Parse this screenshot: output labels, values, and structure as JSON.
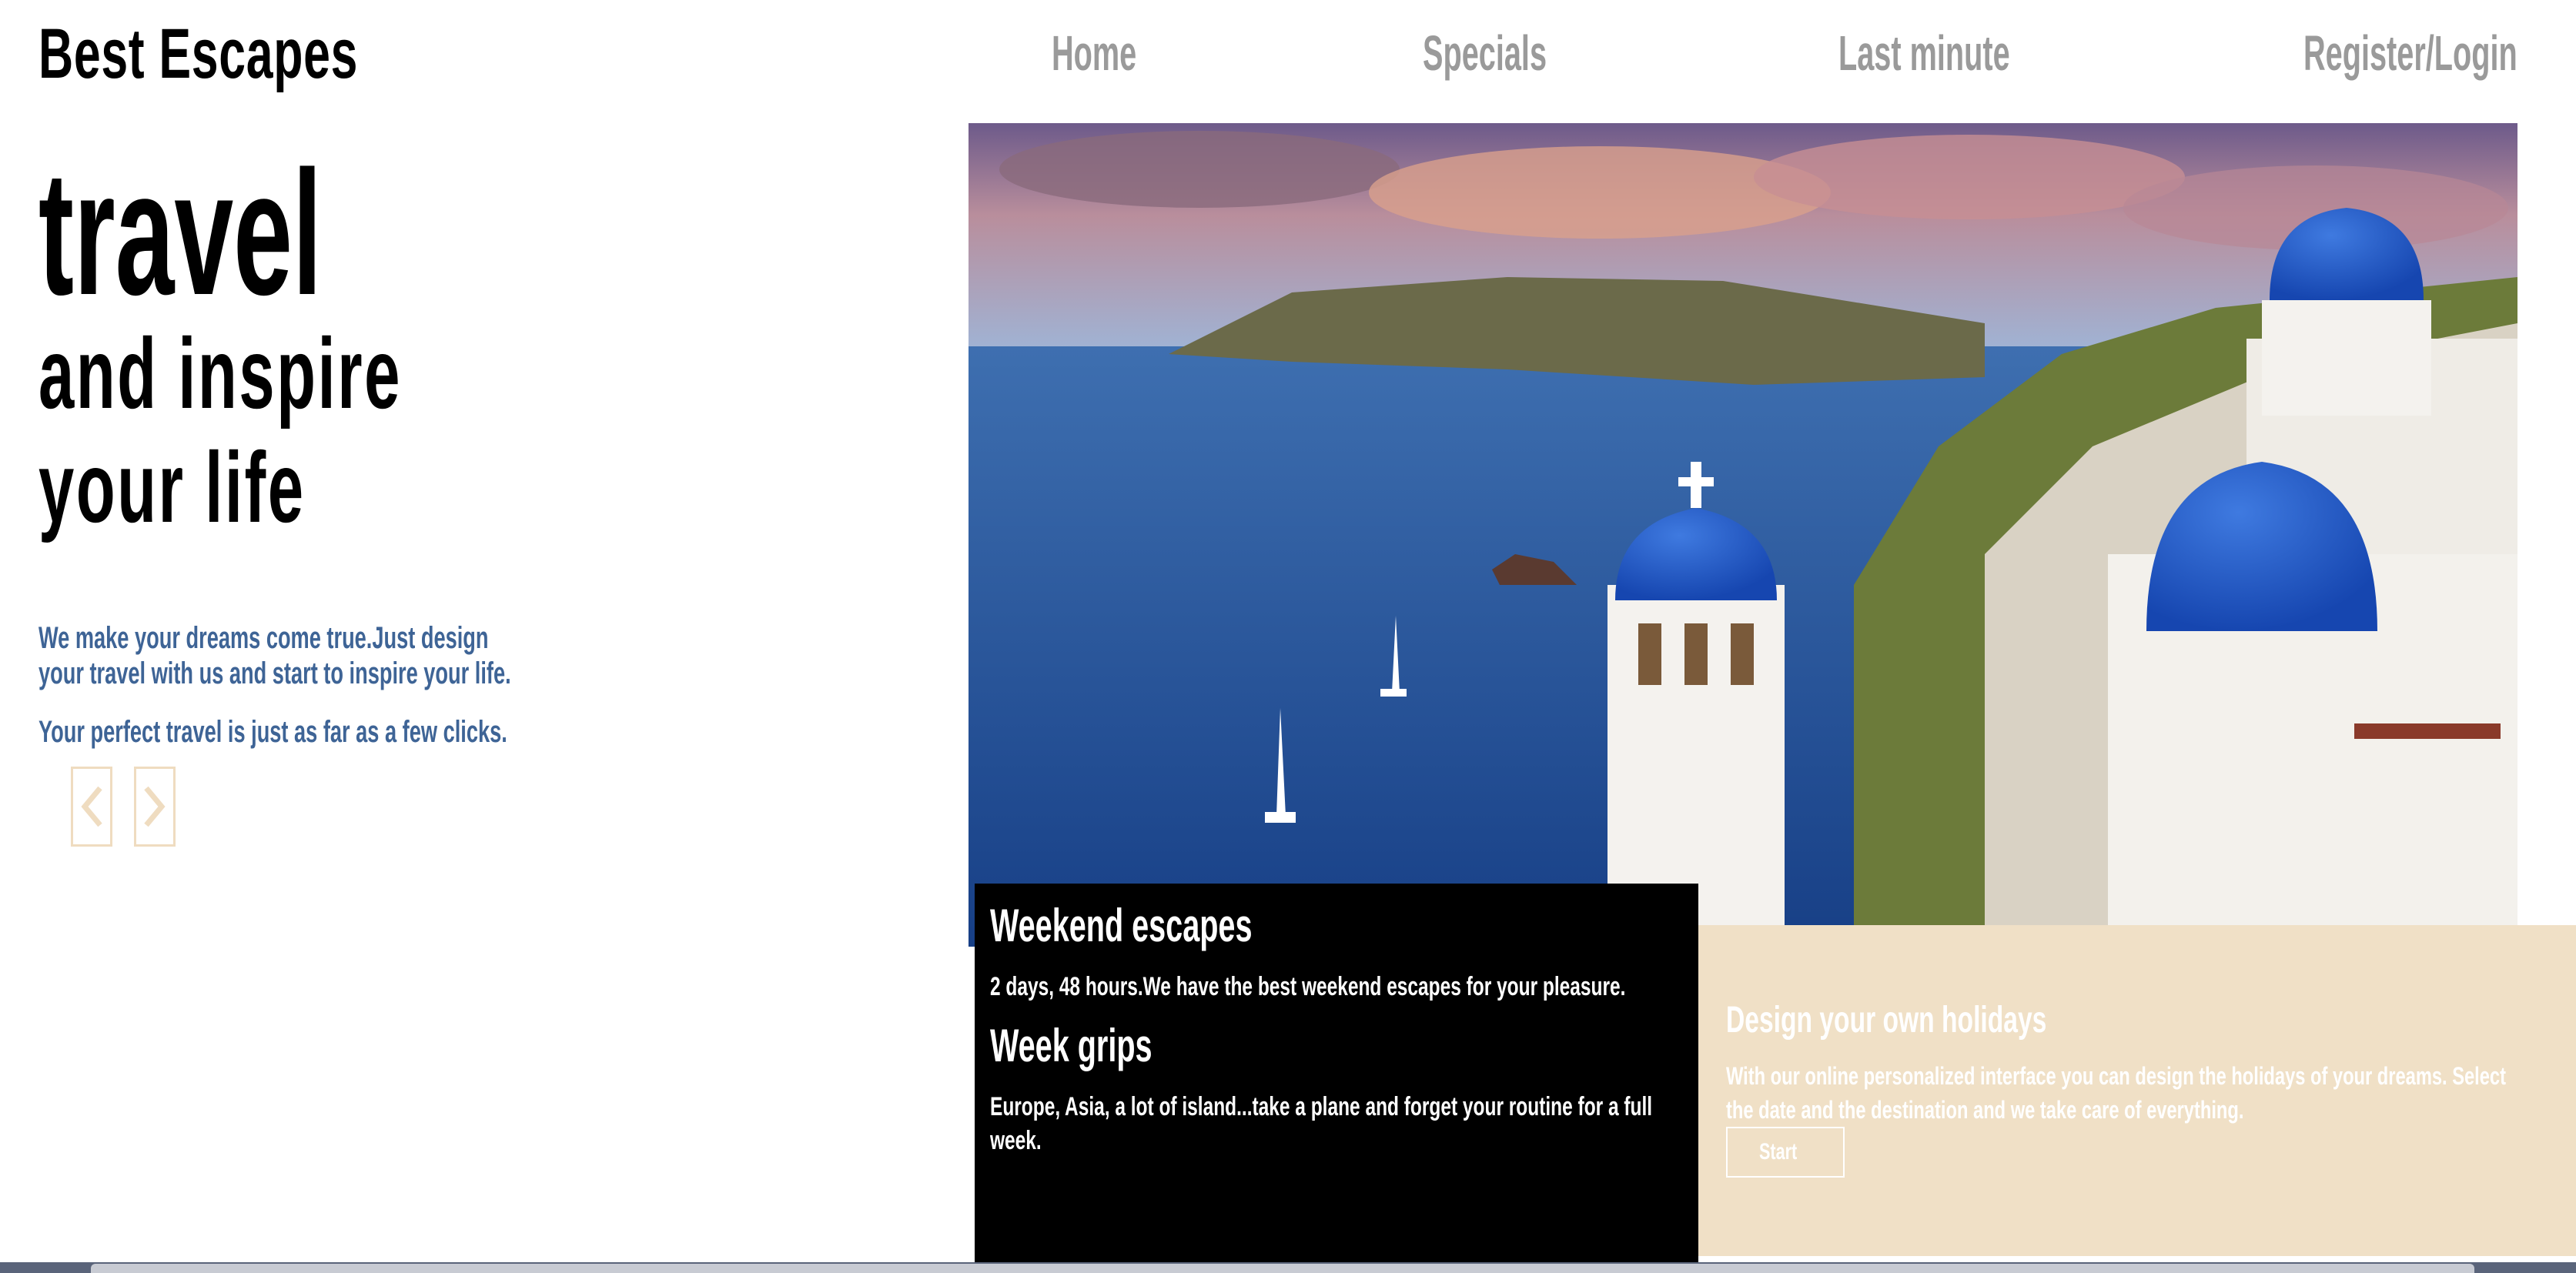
{
  "brand": {
    "name": "Best Escapes"
  },
  "nav": {
    "home": "Home",
    "specials": "Specials",
    "last_minute": "Last minute",
    "register_login": "Register/Login"
  },
  "hero": {
    "line1": "travel",
    "line2": "and inspire",
    "line3": "your life",
    "intro_line1": "We make your dreams come true.Just design",
    "intro_line2": "your travel with us and start to inspire your life.",
    "intro_line3": "Your perfect travel is just as far as a few clicks."
  },
  "carousel": {
    "prev_icon": "chevron-left-icon",
    "next_icon": "chevron-right-icon"
  },
  "card_black": {
    "title1": "Weekend escapes",
    "text1": "2 days, 48 hours.We have the best weekend escapes for your pleasure.",
    "title2": "Week grips",
    "text2_line1": "Europe, Asia, a lot of island...take a plane and forget your routine for a full",
    "text2_line2": "week."
  },
  "card_beige": {
    "title": "Design your own holidays",
    "text_line1": "With our online personalized interface you can design the holidays of your dreams. Select",
    "text_line2": "the date and the destination and we take care of everything.",
    "button": "Start"
  },
  "colors": {
    "accent_blue": "#3e6496",
    "beige": "#f0e0c6",
    "nav_gray": "#9a9a9a"
  }
}
